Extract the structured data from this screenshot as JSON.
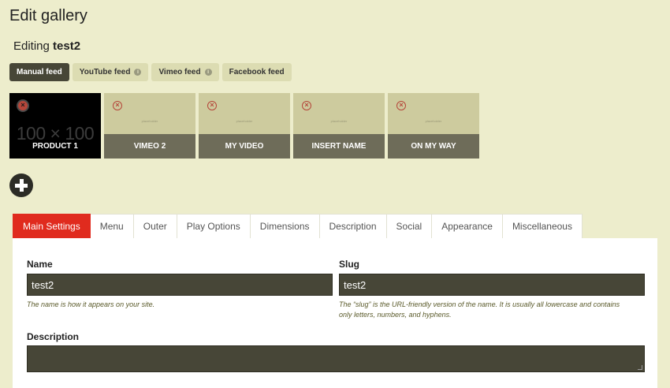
{
  "page": {
    "title": "Edit gallery",
    "editing_prefix": "Editing",
    "gallery_name": "test2"
  },
  "feed_tabs": [
    {
      "label": "Manual feed",
      "active": true,
      "info": false
    },
    {
      "label": "YouTube feed",
      "active": false,
      "info": true
    },
    {
      "label": "Vimeo feed",
      "active": false,
      "info": true
    },
    {
      "label": "Facebook feed",
      "active": false,
      "info": false
    }
  ],
  "thumbnails": [
    {
      "label": "PRODUCT 1",
      "image_text": "100 × 100"
    },
    {
      "label": "VIMEO 2",
      "image_text": "placeholder"
    },
    {
      "label": "MY VIDEO",
      "image_text": "placeholder"
    },
    {
      "label": "INSERT NAME",
      "image_text": "placeholder"
    },
    {
      "label": "ON MY WAY",
      "image_text": "placeholder"
    }
  ],
  "settings_tabs": [
    {
      "label": "Main Settings",
      "active": true
    },
    {
      "label": "Menu",
      "active": false
    },
    {
      "label": "Outer",
      "active": false
    },
    {
      "label": "Play Options",
      "active": false
    },
    {
      "label": "Dimensions",
      "active": false
    },
    {
      "label": "Description",
      "active": false
    },
    {
      "label": "Social",
      "active": false
    },
    {
      "label": "Appearance",
      "active": false
    },
    {
      "label": "Miscellaneous",
      "active": false
    }
  ],
  "form": {
    "name_label": "Name",
    "name_value": "test2",
    "name_help": "The name is how it appears on your site.",
    "slug_label": "Slug",
    "slug_value": "test2",
    "slug_help_line1": "The “slug” is the URL-friendly version of the name. It is usually all lowercase and contains",
    "slug_help_line2": "only letters, numbers, and hyphens.",
    "description_label": "Description",
    "description_value": ""
  },
  "icons": {
    "info": "info-icon",
    "delete": "delete-icon",
    "add": "plus-icon"
  },
  "colors": {
    "background": "#ededcc",
    "active_feed_tab": "#474637",
    "active_settings_tab": "#e02b1e",
    "input_background": "#474637",
    "thumbnail_label_bar": "#6e6c59"
  }
}
